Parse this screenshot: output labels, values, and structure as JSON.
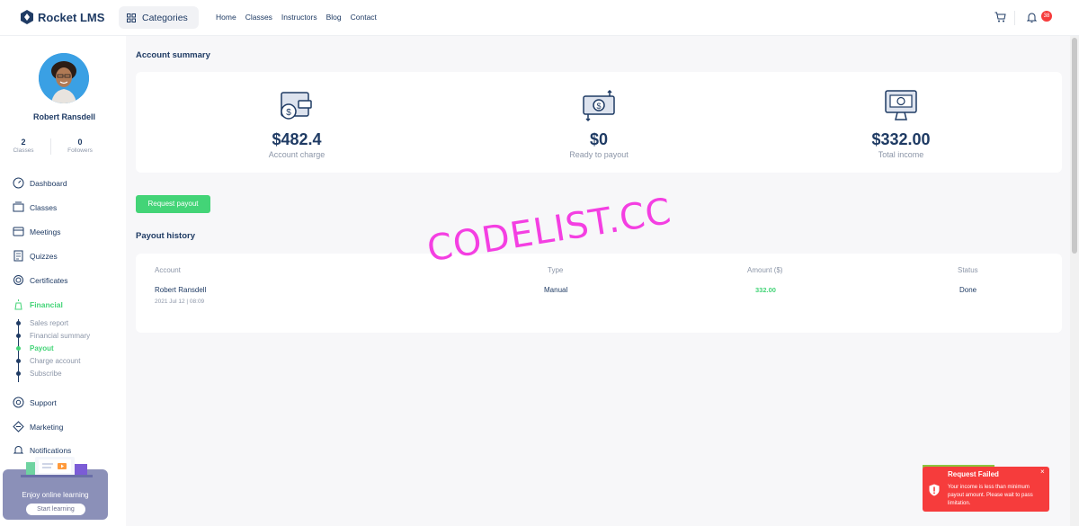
{
  "header": {
    "logo_text": "Rocket LMS",
    "categories_label": "Categories",
    "nav": [
      "Home",
      "Classes",
      "Instructors",
      "Blog",
      "Contact"
    ],
    "notification_count": "38"
  },
  "sidebar": {
    "user_name": "Robert Ransdell",
    "stats": [
      {
        "value": "2",
        "label": "Classes"
      },
      {
        "value": "0",
        "label": "Followers"
      }
    ],
    "menu": [
      {
        "label": "Dashboard",
        "icon": "dashboard-icon"
      },
      {
        "label": "Classes",
        "icon": "classes-icon"
      },
      {
        "label": "Meetings",
        "icon": "meetings-icon"
      },
      {
        "label": "Quizzes",
        "icon": "quizzes-icon"
      },
      {
        "label": "Certificates",
        "icon": "certificate-icon"
      },
      {
        "label": "Financial",
        "icon": "financial-icon"
      },
      {
        "label": "Support",
        "icon": "support-icon"
      },
      {
        "label": "Marketing",
        "icon": "marketing-icon"
      },
      {
        "label": "Notifications",
        "icon": "notifications-icon"
      }
    ],
    "financial_sub": [
      "Sales report",
      "Financial summary",
      "Payout",
      "Charge account",
      "Subscribe"
    ],
    "promo": {
      "title": "Enjoy online learning",
      "button": "Start learning"
    }
  },
  "main": {
    "summary_title": "Account summary",
    "summary": [
      {
        "value": "$482.4",
        "label": "Account charge",
        "icon": "wallet-icon"
      },
      {
        "value": "$0",
        "label": "Ready to payout",
        "icon": "money-transfer-icon"
      },
      {
        "value": "$332.00",
        "label": "Total income",
        "icon": "monitor-money-icon"
      }
    ],
    "request_payout": "Request payout",
    "history_title": "Payout history",
    "columns": [
      "Account",
      "Type",
      "Amount ($)",
      "Status"
    ],
    "rows": [
      {
        "account": "Robert Ransdell",
        "date": "2021 Jul 12 | 08:09",
        "type": "Manual",
        "amount": "332.00",
        "status": "Done"
      }
    ]
  },
  "watermark": "CODELIST.CC",
  "toast": {
    "title": "Request Failed",
    "message": "Your income is less than minimum payout amount. Please wait to pass limitation.",
    "close": "×"
  },
  "colors": {
    "accent": "#43d477",
    "primary": "#1f3b64",
    "danger": "#f63c3c"
  }
}
